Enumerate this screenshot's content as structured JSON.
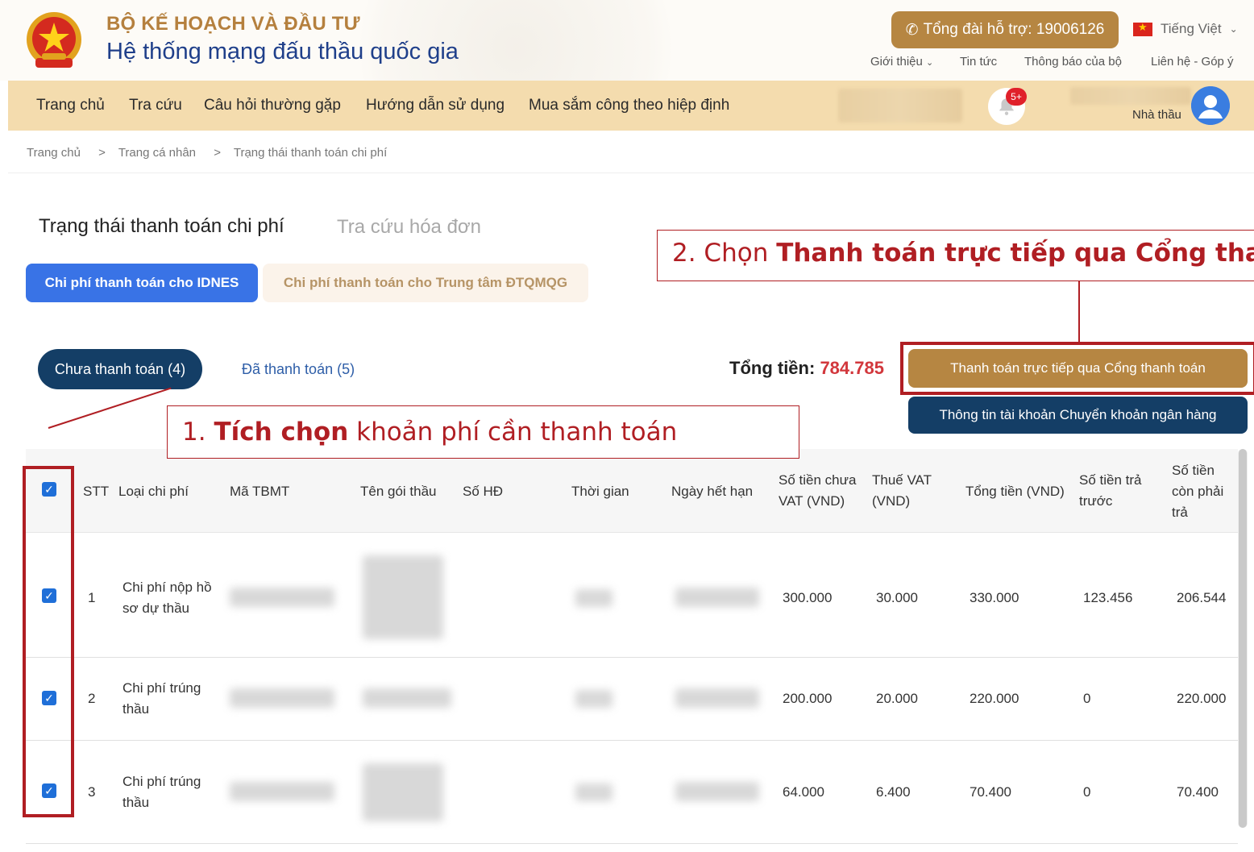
{
  "header": {
    "org_name": "BỘ KẾ HOẠCH VÀ ĐẦU TƯ",
    "site_name": "Hệ thống mạng đấu thầu quốc gia",
    "hotline": "Tổng đài hỗ trợ: 19006126",
    "language": "Tiếng Việt",
    "links": [
      "Giới thiệu",
      "Tin tức",
      "Thông báo của bộ",
      "Liên hệ - Góp ý"
    ]
  },
  "nav": {
    "items": [
      "Trang chủ",
      "Tra cứu",
      "Câu hỏi thường gặp",
      "Hướng dẫn sử dụng",
      "Mua sắm công theo hiệp định"
    ],
    "notification_count": "5+",
    "role": "Nhà thầu"
  },
  "breadcrumb": [
    "Trang chủ",
    "Trang cá nhân",
    "Trạng thái thanh toán chi phí"
  ],
  "tabs": {
    "active": "Trạng thái thanh toán chi phí",
    "inactive": "Tra cứu hóa đơn"
  },
  "cost_tabs": {
    "idnes": "Chi phí thanh toán cho IDNES",
    "center": "Chi phí thanh toán cho Trung tâm ĐTQMQG"
  },
  "status": {
    "unpaid": "Chưa thanh toán (4)",
    "paid": "Đã thanh toán (5)"
  },
  "total": {
    "label": "Tổng tiền:",
    "value": "784.785"
  },
  "actions": {
    "pay_gateway": "Thanh toán trực tiếp qua Cổng thanh toán",
    "bank_info": "Thông tin tài khoản Chuyển khoản ngân hàng"
  },
  "annotations": {
    "step1_prefix": "1. ",
    "step1_bold": "Tích chọn",
    "step1_rest": " khoản phí cần thanh toán",
    "step2_prefix": "2. Chọn ",
    "step2_bold": "Thanh toán trực tiếp qua Cổng thanh toán"
  },
  "table": {
    "headers": {
      "stt": "STT",
      "type": "Loại chi phí",
      "tbmt": "Mã TBMT",
      "package": "Tên gói thầu",
      "contract": "Số HĐ",
      "time": "Thời gian",
      "expiry": "Ngày hết hạn",
      "pre_vat_1": "Số tiền chưa",
      "pre_vat_2": "VAT (VND)",
      "vat_1": "Thuế VAT",
      "vat_2": "(VND)",
      "total": "Tổng tiền (VND)",
      "prepaid_1": "Số tiền trả",
      "prepaid_2": "trước",
      "remaining_1": "Số tiền",
      "remaining_2": "còn phải",
      "remaining_3": "trả"
    },
    "rows": [
      {
        "stt": "1",
        "type_1": "Chi phí nộp hồ",
        "type_2": "sơ dự thầu",
        "pre_vat": "300.000",
        "vat": "30.000",
        "total": "330.000",
        "prepaid": "123.456",
        "remaining": "206.544"
      },
      {
        "stt": "2",
        "type_1": "Chi phí trúng",
        "type_2": "thầu",
        "pre_vat": "200.000",
        "vat": "20.000",
        "total": "220.000",
        "prepaid": "0",
        "remaining": "220.000"
      },
      {
        "stt": "3",
        "type_1": "Chi phí trúng",
        "type_2": "thầu",
        "pre_vat": "64.000",
        "vat": "6.400",
        "total": "70.400",
        "prepaid": "0",
        "remaining": "70.400"
      }
    ]
  },
  "colors": {
    "brand_gold": "#b68642",
    "brand_navy": "#143e66",
    "accent_blue": "#3973e6",
    "annotation_red": "#b01e23",
    "total_red": "#d2373c"
  }
}
